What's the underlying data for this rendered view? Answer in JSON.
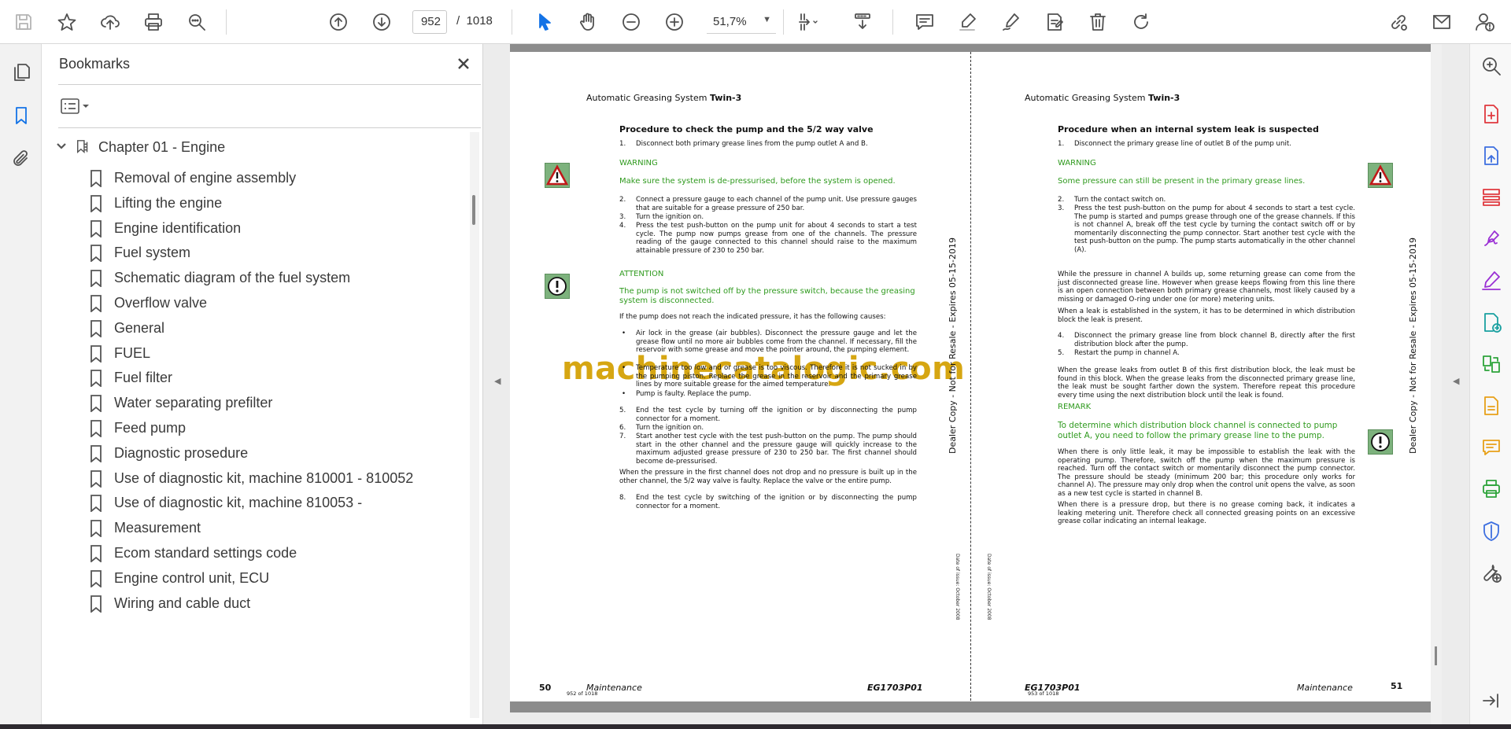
{
  "toolbar": {
    "current_page": "952",
    "page_separator": "/",
    "total_pages": "1018",
    "zoom": "51,7%"
  },
  "bookmarks_panel": {
    "title": "Bookmarks",
    "chapter": "Chapter 01 - Engine",
    "items": [
      "Removal of engine assembly",
      "Lifting the engine",
      "Engine identification",
      "Fuel system",
      "Schematic diagram of the fuel system",
      "Overflow valve",
      "General",
      "FUEL",
      "Fuel filter",
      "Water separating prefilter",
      "Feed pump",
      "Diagnostic prosedure",
      "Use of diagnostic kit, machine  810001 -  810052",
      "Use of diagnostic kit, machine  810053 -",
      "Measurement",
      "Ecom standard settings code",
      "Engine control unit, ECU",
      "Wiring and cable duct"
    ]
  },
  "document": {
    "watermark": "machinecatalogic.com",
    "left_page": {
      "header_plain": "Automatic Greasing System ",
      "header_bold": "Twin-3",
      "heading": "Procedure to check the pump and the 5/2 way valve",
      "step1": "Disconnect both primary grease lines from the pump outlet A and B.",
      "warning_label": "WARNING",
      "warning_text": "Make sure the system is de-pressurised, before the system is opened.",
      "step2": "Connect a pressure gauge to each channel of the pump unit. Use pressure gauges that are suitable for a grease pressure of 250 bar.",
      "step3": "Turn the ignition on.",
      "step4": "Press the test push-button on the pump unit for about 4 seconds to start a test cycle. The pump now pumps grease from one of the channels. The pressure reading of the gauge connected to this channel should raise to the maximum attainable pressure of 230 to 250 bar.",
      "attention_label": "ATTENTION",
      "attention_text": "The pump is not switched off by the pressure switch, because the greasing system is disconnected.",
      "causes_intro": "If the pump does not reach the indicated pressure, it has the following causes:",
      "bullet1": "Air lock in the grease (air bubbles). Disconnect the pressure gauge and let the grease flow until no more air bubbles come from the channel. If necessary, fill the reservoir with some grease and move the pointer around, the pumping element.",
      "bullet2": "Temperature too low and or grease is too viscous. Therefore it is not sucked in by the pumping piston. Replace the grease in the reservoir and the primary grease lines by more suitable grease for the aimed temperature.",
      "bullet3": "Pump is faulty. Replace the pump.",
      "step5": "End the test cycle by turning off the ignition or by disconnecting the pump connector for a moment.",
      "step6": "Turn the ignition on.",
      "step7": "Start another test cycle with the test push-button on the pump. The pump should start in the other channel and the pressure gauge will quickly increase to the maximum adjusted grease pressure of 230 to 250 bar. The first channel should become de-pressurised.",
      "no_drop": "When the pressure in the first channel does not drop and no pressure is built up in the other channel, the 5/2 way valve is faulty. Replace the valve or the entire pump.",
      "step8": "End the test cycle by switching of the ignition or by disconnecting the pump connector for a moment.",
      "dealer": "Dealer Copy - Not for Resale - Expires 05-15-2019",
      "date_issue": "Date of issue: October 2008",
      "page_num": "50",
      "section": "Maintenance",
      "code": "EG1703P01",
      "page_of": "952 of 1018"
    },
    "right_page": {
      "header_plain": "Automatic Greasing System ",
      "header_bold": "Twin-3",
      "heading": "Procedure when an internal system leak is suspected",
      "step1": "Disconnect the primary grease line of outlet B of the pump unit.",
      "warning_label": "WARNING",
      "warning_text": "Some pressure can still be present in the primary grease lines.",
      "step2": "Turn the contact switch on.",
      "step3": "Press the test push-button on the pump for about 4 seconds to start a test cycle. The pump is started and pumps grease through one of the grease channels. If this is not channel A, break off the test cycle by turning the contact switch off or by momentarily disconnecting the pump connector. Start another test cycle with the test push-button on the pump. The pump starts automatically in the other channel (A).",
      "para1": "While the pressure in channel A builds up, some returning grease can come from the just disconnected grease line. However when grease keeps flowing from this line there is an open connection between both primary grease channels, most likely caused by a missing or damaged O-ring under one (or more) metering units.",
      "para2": "When a leak is established in the system, it has to be determined in which distribution block the leak is present.",
      "step4": "Disconnect the primary grease line from block channel B, directly after the first distribution block after the pump.",
      "step5": "Restart the pump in channel A.",
      "para3": "When the grease leaks from outlet B of this first distribution block, the leak must be found in this block. When the grease leaks from the disconnected primary grease line, the leak must be sought farther down the system. Therefore repeat this procedure every time using the next distribution block until the leak is found.",
      "remark_label": "REMARK",
      "remark_text": "To determine which distribution block channel is connected to pump outlet A, you need to follow the primary grease line to the pump.",
      "para4": "When there is only little leak, it may be impossible to establish the leak with the operating pump. Therefore, switch off the pump when the maximum pressure is reached. Turn off the contact switch or momentarily disconnect the pump connector. The pressure should be steady (minimum 200 bar; this procedure only works for channel A). The pressure may only drop when the control unit opens the valve, as soon as a new test cycle is started in channel B.",
      "para5": "When there is a pressure drop, but there is no grease coming back, it indicates a leaking metering unit. Therefore check all connected greasing points on an excessive grease collar indicating an internal leakage.",
      "dealer": "Dealer Copy - Not for Resale - Expires 05-15-2019",
      "date_issue": "Date of issue: October 2008",
      "page_num": "51",
      "section": "Maintenance",
      "code": "EG1703P01",
      "page_of": "953 of 1018"
    }
  },
  "colors": {
    "accent": "#1473e6",
    "doc_green": "#2f9a1e",
    "watermark": "#d4a206",
    "warning_box": "#7db27d"
  },
  "icons": {
    "toolbar": [
      "save-icon",
      "star-icon",
      "upload-icon",
      "print-icon",
      "search-zoom-icon",
      "page-up-icon",
      "page-down-icon",
      "select-cursor-icon",
      "hand-icon",
      "zoom-out-icon",
      "zoom-in-icon",
      "fit-page-icon",
      "scroll-mode-icon",
      "comment-icon",
      "highlight-icon",
      "draw-icon",
      "stamp-icon",
      "delete-icon",
      "rotate-icon",
      "share-link-icon",
      "mail-icon",
      "account-icon"
    ],
    "left_rail": [
      "pages-icon",
      "bookmark-icon",
      "attachment-icon"
    ],
    "right_rail": [
      "zoom-search-icon",
      "create-pdf-icon",
      "export-pdf-icon",
      "organize-pages-icon",
      "fill-sign-icon",
      "edit-pdf-icon",
      "send-review-icon",
      "compare-icon",
      "export-file-icon",
      "comment-icon",
      "print-production-icon",
      "protect-icon",
      "more-tools-icon",
      "expand-icon"
    ]
  }
}
